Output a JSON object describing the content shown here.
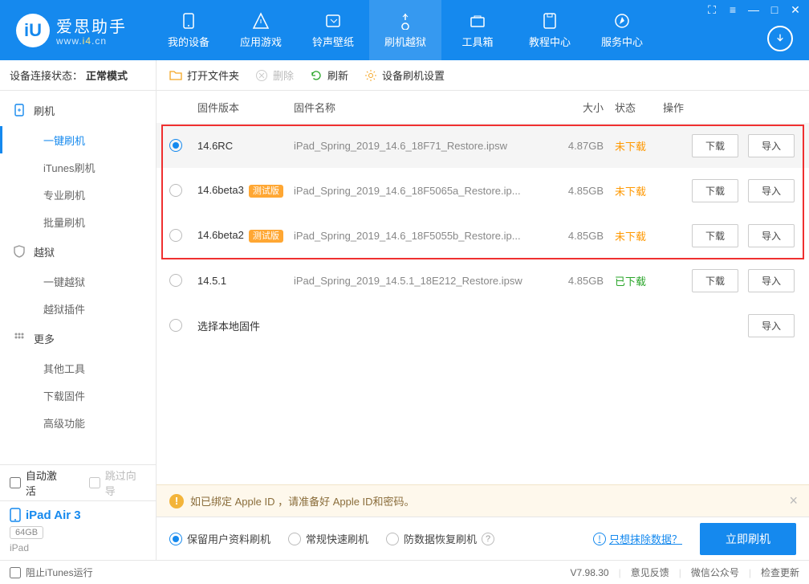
{
  "brand": {
    "name": "爱思助手",
    "url_pre": "www.",
    "url_accent": "i4",
    "url_post": ".cn"
  },
  "nav": [
    {
      "label": "我的设备"
    },
    {
      "label": "应用游戏"
    },
    {
      "label": "铃声壁纸"
    },
    {
      "label": "刷机越狱"
    },
    {
      "label": "工具箱"
    },
    {
      "label": "教程中心"
    },
    {
      "label": "服务中心"
    }
  ],
  "deviceStatus": {
    "label": "设备连接状态：",
    "mode": "正常模式"
  },
  "sidebar": {
    "groups": [
      {
        "label": "刷机",
        "items": [
          "一键刷机",
          "iTunes刷机",
          "专业刷机",
          "批量刷机"
        ]
      },
      {
        "label": "越狱",
        "items": [
          "一键越狱",
          "越狱插件"
        ]
      },
      {
        "label": "更多",
        "items": [
          "其他工具",
          "下载固件",
          "高级功能"
        ]
      }
    ],
    "autoActivate": "自动激活",
    "skipGuide": "跳过向导"
  },
  "device": {
    "name": "iPad Air 3",
    "storage": "64GB",
    "type": "iPad"
  },
  "toolbar": {
    "open": "打开文件夹",
    "delete": "删除",
    "refresh": "刷新",
    "settings": "设备刷机设置"
  },
  "columns": {
    "ver": "固件版本",
    "name": "固件名称",
    "size": "大小",
    "status": "状态",
    "ops": "操作"
  },
  "rows": [
    {
      "sel": true,
      "ver": "14.6RC",
      "beta": false,
      "name": "iPad_Spring_2019_14.6_18F71_Restore.ipsw",
      "size": "4.87GB",
      "status": "未下载",
      "statusClass": "st-pending",
      "dl": true
    },
    {
      "sel": false,
      "ver": "14.6beta3",
      "beta": true,
      "name": "iPad_Spring_2019_14.6_18F5065a_Restore.ip...",
      "size": "4.85GB",
      "status": "未下载",
      "statusClass": "st-pending",
      "dl": true
    },
    {
      "sel": false,
      "ver": "14.6beta2",
      "beta": true,
      "name": "iPad_Spring_2019_14.6_18F5055b_Restore.ip...",
      "size": "4.85GB",
      "status": "未下载",
      "statusClass": "st-pending",
      "dl": true
    },
    {
      "sel": false,
      "ver": "14.5.1",
      "beta": false,
      "name": "iPad_Spring_2019_14.5.1_18E212_Restore.ipsw",
      "size": "4.85GB",
      "status": "已下载",
      "statusClass": "st-done",
      "dl": true
    }
  ],
  "labels": {
    "betaBadge": "测试版",
    "download": "下载",
    "import": "导入",
    "localFw": "选择本地固件"
  },
  "warning": "如已绑定 Apple ID ，请准备好 Apple ID和密码。",
  "actions": {
    "keepData": "保留用户资料刷机",
    "normal": "常规快速刷机",
    "antiRecover": "防数据恢复刷机",
    "eraseLink": "只想抹除数据？",
    "go": "立即刷机"
  },
  "footer": {
    "blockItunes": "阻止iTunes运行",
    "version": "V7.98.30",
    "feedback": "意见反馈",
    "wechat": "微信公众号",
    "update": "检查更新"
  }
}
